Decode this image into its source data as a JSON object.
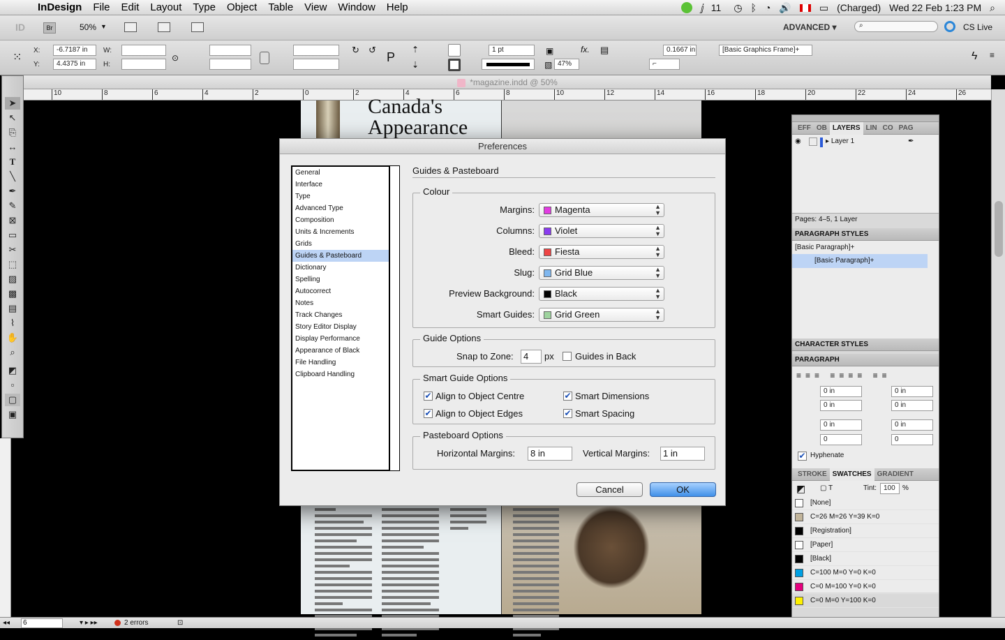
{
  "menubar": {
    "app": "InDesign",
    "menus": [
      "File",
      "Edit",
      "Layout",
      "Type",
      "Object",
      "Table",
      "View",
      "Window",
      "Help"
    ],
    "status": {
      "ai_badge": "11",
      "battery": "(Charged)",
      "clock": "Wed 22 Feb  1:23 PM"
    }
  },
  "appbar": {
    "zoom": "50%",
    "workspace": "ADVANCED ▾",
    "cs_live": "CS Live",
    "br": "Br"
  },
  "control": {
    "x_label": "X:",
    "x_value": "-6.7187 in",
    "y_label": "Y:",
    "y_value": "4.4375 in",
    "w_label": "W:",
    "h_label": "H:",
    "stroke_weight": "1 pt",
    "opacity": "47%",
    "gap": "0.1667 in",
    "object_style": "[Basic Graphics Frame]+"
  },
  "document": {
    "title": "*magazine.indd @ 50%",
    "headline_1": "Canada's",
    "headline_2": "Appearance"
  },
  "ruler": {
    "ticks": [
      "10",
      "8",
      "6",
      "4",
      "2",
      "0",
      "2",
      "4",
      "6",
      "8",
      "10",
      "12",
      "14",
      "16",
      "18",
      "20",
      "22",
      "24",
      "26"
    ]
  },
  "statusbar": {
    "page": "6",
    "errors": "2 errors"
  },
  "panels": {
    "layers": {
      "tabs": [
        "EFF",
        "OB",
        "LAYERS",
        "LIN",
        "CO",
        "PAG"
      ],
      "layer": "Layer 1",
      "footer": "Pages: 4–5, 1 Layer"
    },
    "paragraph_styles": {
      "title": "PARAGRAPH STYLES",
      "current": "[Basic Paragraph]+",
      "item": "[Basic Paragraph]+"
    },
    "character_styles": {
      "title": "CHARACTER STYLES"
    },
    "paragraph": {
      "title": "PARAGRAPH",
      "fields": [
        "0 in",
        "0 in",
        "0 in",
        "0 in",
        "0 in",
        "0 in",
        "0",
        "0"
      ],
      "hyphenate": "Hyphenate"
    },
    "swatches": {
      "tabs": [
        "STROKE",
        "SWATCHES",
        "GRADIENT"
      ],
      "tint_label": "Tint:",
      "tint": "100",
      "pct": "%",
      "items": [
        {
          "name": "[None]",
          "color": "#ffffff"
        },
        {
          "name": "C=26 M=26 Y=39 K=0",
          "color": "#c2b59b"
        },
        {
          "name": "[Registration]",
          "color": "#000000"
        },
        {
          "name": "[Paper]",
          "color": "#ffffff"
        },
        {
          "name": "[Black]",
          "color": "#000000"
        },
        {
          "name": "C=100 M=0 Y=0 K=0",
          "color": "#00a0e3"
        },
        {
          "name": "C=0 M=100 Y=0 K=0",
          "color": "#e6007e"
        },
        {
          "name": "C=0 M=0 Y=100 K=0",
          "color": "#fff200"
        }
      ]
    }
  },
  "dialog": {
    "title": "Preferences",
    "categories": [
      "General",
      "Interface",
      "Type",
      "Advanced Type",
      "Composition",
      "Units & Increments",
      "Grids",
      "Guides & Pasteboard",
      "Dictionary",
      "Spelling",
      "Autocorrect",
      "Notes",
      "Track Changes",
      "Story Editor Display",
      "Display Performance",
      "Appearance of Black",
      "File Handling",
      "Clipboard Handling"
    ],
    "selected_category": "Guides & Pasteboard",
    "section_title": "Guides & Pasteboard",
    "colour": {
      "title": "Colour",
      "rows": [
        {
          "label": "Margins:",
          "value": "Magenta",
          "color": "#e23ce2"
        },
        {
          "label": "Columns:",
          "value": "Violet",
          "color": "#8a3cf0"
        },
        {
          "label": "Bleed:",
          "value": "Fiesta",
          "color": "#ee4444"
        },
        {
          "label": "Slug:",
          "value": "Grid Blue",
          "color": "#7fb7ef"
        },
        {
          "label": "Preview Background:",
          "value": "Black",
          "color": "#000000"
        },
        {
          "label": "Smart Guides:",
          "value": "Grid Green",
          "color": "#9ed39e"
        }
      ]
    },
    "guide_options": {
      "title": "Guide Options",
      "snap_label": "Snap to Zone:",
      "snap_value": "4",
      "snap_unit": "px",
      "guides_in_back": "Guides in Back"
    },
    "smart_guide_options": {
      "title": "Smart Guide Options",
      "align_centre": "Align to Object Centre",
      "align_edges": "Align to Object Edges",
      "smart_dimensions": "Smart Dimensions",
      "smart_spacing": "Smart Spacing"
    },
    "pasteboard_options": {
      "title": "Pasteboard Options",
      "h_label": "Horizontal Margins:",
      "h_value": "8 in",
      "v_label": "Vertical Margins:",
      "v_value": "1 in"
    },
    "cancel": "Cancel",
    "ok": "OK"
  }
}
